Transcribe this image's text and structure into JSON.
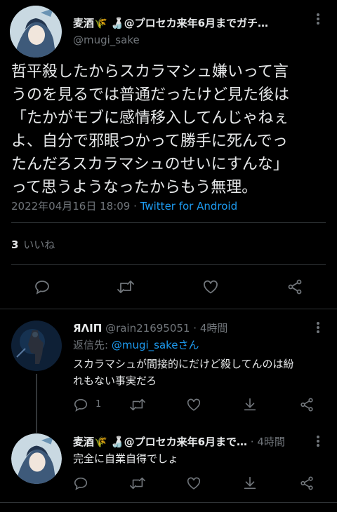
{
  "main_tweet": {
    "display_name": "麦酒🌾 🍶@プロセカ来年6月までガチ…",
    "handle": "@mugi_sake",
    "lines": [
      "哲平殺したからスカラマシュ嫌いって言",
      "うのを見るでは普通だったけど見た後は",
      "「たかがモブに感情移入してんじゃねぇ",
      "よ、自分で邪眼つかって勝手に死んでっ",
      "たんだろスカラマシュのせいにすんな」",
      "って思うようなったからもう無理。"
    ],
    "timestamp": "2022年04月16日 18:09",
    "separator": "·",
    "source": "Twitter for Android",
    "likes_count": "3",
    "likes_label": "いいね"
  },
  "reply1": {
    "display_name": "ЯΛIП",
    "handle": "@rain21695051",
    "separator": "·",
    "time": "4時間",
    "reply_to_prefix": "返信先: ",
    "reply_to_handle": "@mugi_sake",
    "reply_to_suffix": "さん",
    "lines": [
      "スカラマシュが間接的にだけど殺してんのは紛",
      "れもない事実だろ"
    ],
    "reply_count": "1"
  },
  "reply2": {
    "display_name": "麦酒🌾 🍶@プロセカ来年6月まで…",
    "separator": "·",
    "time": "4時間",
    "text": "完全に自業自得でしょ"
  },
  "colors": {
    "background": "#000000",
    "text": "#e7e9ea",
    "secondary": "#71767b",
    "link": "#1d9bf0",
    "divider": "#2f3336"
  },
  "icons": [
    "reply-icon",
    "retweet-icon",
    "like-icon",
    "share-icon",
    "download-icon",
    "more-dots-icon"
  ]
}
